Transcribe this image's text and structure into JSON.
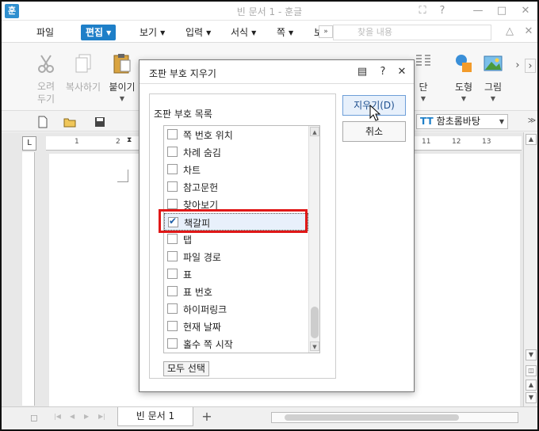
{
  "window": {
    "app_icon": "훈",
    "title": "빈 문서 1 - 훈글"
  },
  "menubar": {
    "items": [
      "파일",
      "편집",
      "보기",
      "입력",
      "서식",
      "쪽",
      "보"
    ],
    "active_index": 1,
    "search_placeholder": "찾을 내용"
  },
  "ribbon": {
    "cut": "오려\n두기",
    "copy": "복사하기",
    "paste": "붙이기",
    "dan": "단",
    "shape": "도형",
    "picture": "그림"
  },
  "toolbar2": {
    "font": "함초롬바탕",
    "font_icon": "TT"
  },
  "dialog": {
    "title": "조판 부호 지우기",
    "group_label": "조판 부호 목록",
    "items": [
      {
        "label": "쪽 번호 위치",
        "checked": false
      },
      {
        "label": "차례 숨김",
        "checked": false
      },
      {
        "label": "차트",
        "checked": false
      },
      {
        "label": "참고문헌",
        "checked": false
      },
      {
        "label": "찾아보기",
        "checked": false
      },
      {
        "label": "책갈피",
        "checked": true
      },
      {
        "label": "탭",
        "checked": false
      },
      {
        "label": "파일 경로",
        "checked": false
      },
      {
        "label": "표",
        "checked": false
      },
      {
        "label": "표 번호",
        "checked": false
      },
      {
        "label": "하이퍼링크",
        "checked": false
      },
      {
        "label": "현재 날짜",
        "checked": false
      },
      {
        "label": "홀수 쪽 시작",
        "checked": false
      }
    ],
    "select_all": "모두 선택",
    "ok": "지우기(D)",
    "cancel": "취소"
  },
  "tabbar": {
    "doc_tab": "빈 문서 1",
    "add": "+"
  },
  "ruler_numbers": [
    "1",
    "2",
    "11",
    "12",
    "13"
  ]
}
